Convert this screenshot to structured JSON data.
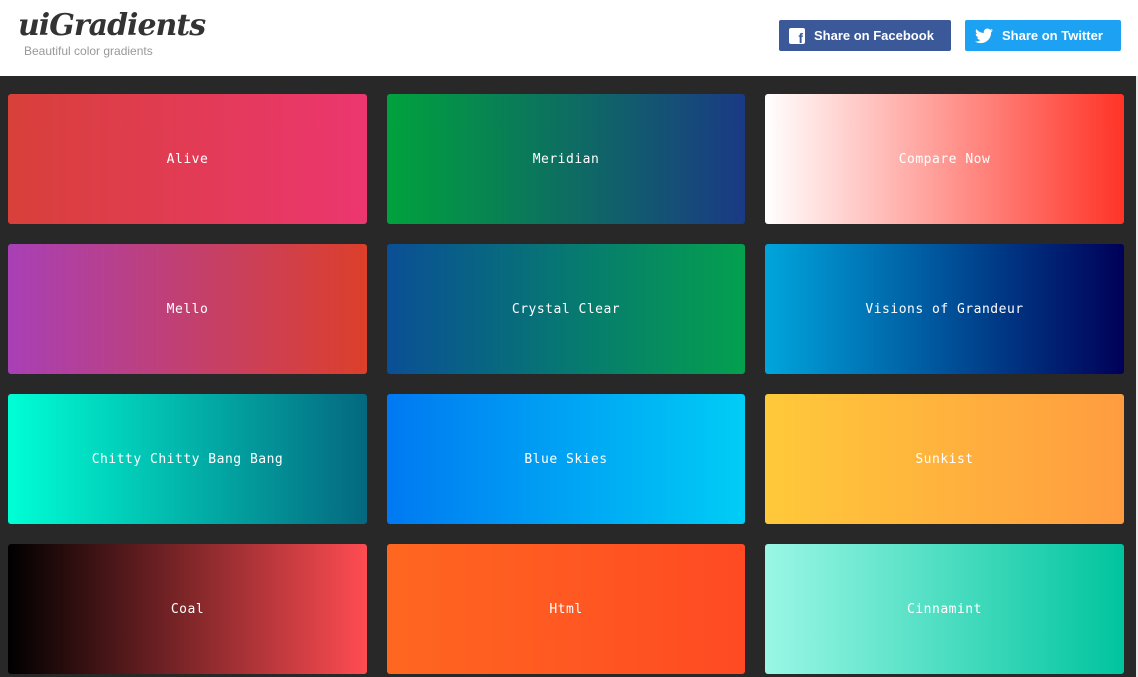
{
  "header": {
    "logo": "uiGradients",
    "tagline": "Beautiful color gradients",
    "facebook_label": "Share on Facebook",
    "twitter_label": "Share on Twitter",
    "facebook_icon": "facebook-icon",
    "twitter_icon": "twitter-icon"
  },
  "gradients": [
    {
      "name": "Alive",
      "from": "#d8403a",
      "to": "#ec3670"
    },
    {
      "name": "Meridian",
      "from": "#00a23d",
      "to": "#1a3a85"
    },
    {
      "name": "Compare Now",
      "from": "#ffffff",
      "to": "#ff3327"
    },
    {
      "name": "Mello",
      "from": "#a840b6",
      "to": "#dc3f2a"
    },
    {
      "name": "Crystal Clear",
      "from": "#0a4f96",
      "to": "#04a04e"
    },
    {
      "name": "Visions of Grandeur",
      "from": "#00a5dc",
      "to": "#000058"
    },
    {
      "name": "Chitty Chitty Bang Bang",
      "from": "#00ffd5",
      "to": "#04687f"
    },
    {
      "name": "Blue Skies",
      "from": "#0079f2",
      "to": "#00cdf5"
    },
    {
      "name": "Sunkist",
      "from": "#ffc93a",
      "to": "#ff9c40"
    },
    {
      "name": "Coal",
      "from": "#000000",
      "to": "#ff4c52"
    },
    {
      "name": "Html",
      "from": "#ff6720",
      "to": "#ff4a23"
    },
    {
      "name": "Cinnamint",
      "from": "#9af7e5",
      "to": "#00c49e"
    }
  ]
}
